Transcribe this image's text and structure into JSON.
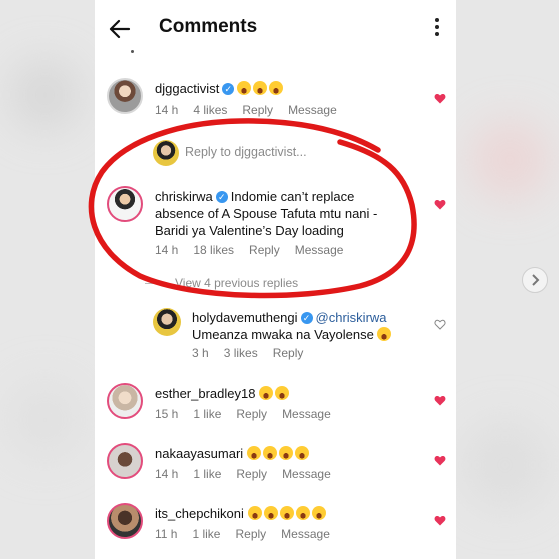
{
  "header": {
    "title": "Comments",
    "back_icon": "back-arrow-icon",
    "more_icon": "more-vertical-icon"
  },
  "reply_input": {
    "placeholder": "Reply to djggactivist..."
  },
  "view_previous_replies": "View 4 previous replies",
  "comments": [
    {
      "username": "djggactivist",
      "verified": true,
      "emojis": 3,
      "text": "",
      "time": "14 h",
      "likes": "4 likes",
      "reply": "Reply",
      "message": "Message"
    },
    {
      "username": "chriskirwa",
      "verified": true,
      "text": "Indomie can’t replace absence of A Spouse Tafuta mtu nani - Baridi ya Valentine’s Day loading",
      "time": "14 h",
      "likes": "18 likes",
      "reply": "Reply",
      "message": "Message"
    },
    {
      "username": "holydavemuthengi",
      "verified": true,
      "mention": "@chriskirwa",
      "text": "Umeanza mwaka na Vayolense",
      "emojis": 1,
      "time": "3 h",
      "likes": "3 likes",
      "reply": "Reply"
    },
    {
      "username": "esther_bradley18",
      "verified": false,
      "emojis": 2,
      "time": "15 h",
      "likes": "1 like",
      "reply": "Reply",
      "message": "Message"
    },
    {
      "username": "nakaayasumari",
      "verified": false,
      "emojis": 4,
      "time": "14 h",
      "likes": "1 like",
      "reply": "Reply",
      "message": "Message"
    },
    {
      "username": "its_chepchikoni",
      "verified": false,
      "emojis": 5,
      "time": "11 h",
      "likes": "1 like",
      "reply": "Reply",
      "message": "Message"
    }
  ],
  "colors": {
    "heart_liked": "#e8335a",
    "annotation_red": "#e01818",
    "verified_blue": "#3897f0"
  }
}
